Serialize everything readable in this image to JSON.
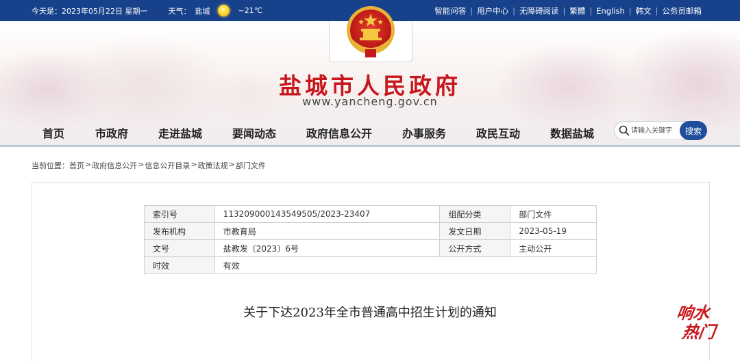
{
  "topbar": {
    "date": "今天是：2023年05月22日 星期一",
    "weather_label": "天气：",
    "city": "盐城",
    "temperature": "~21℃",
    "links": [
      "智能问答",
      "用户中心",
      "无障碍阅读",
      "繁體",
      "English",
      "韩文",
      "公务员邮箱"
    ]
  },
  "header": {
    "title": "盐城市人民政府",
    "url": "www.yancheng.gov.cn"
  },
  "nav": {
    "items": [
      "首页",
      "市政府",
      "走进盐城",
      "要闻动态",
      "政府信息公开",
      "办事服务",
      "政民互动",
      "数据盐城"
    ]
  },
  "search": {
    "placeholder": "请输入关键字",
    "button": "搜索"
  },
  "breadcrumb": {
    "label": "当前位置：",
    "items": [
      "首页",
      "政府信息公开",
      "信息公开目录",
      "政策法规",
      "部门文件"
    ]
  },
  "meta": {
    "rows": [
      [
        "索引号",
        "113209000143549505/2023-23407",
        "组配分类",
        "部门文件"
      ],
      [
        "发布机构",
        "市教育局",
        "发文日期",
        "2023-05-19"
      ],
      [
        "文号",
        "盐教发〔2023〕6号",
        "公开方式",
        "主动公开"
      ],
      [
        "时效",
        "有效"
      ]
    ]
  },
  "document": {
    "title": "关于下达2023年全市普通高中招生计划的通知"
  },
  "watermark": {
    "text": "响水热门"
  },
  "colors": {
    "topbar": "#17418a",
    "title_red": "#c8161d",
    "search_button": "#1f4e9a"
  }
}
